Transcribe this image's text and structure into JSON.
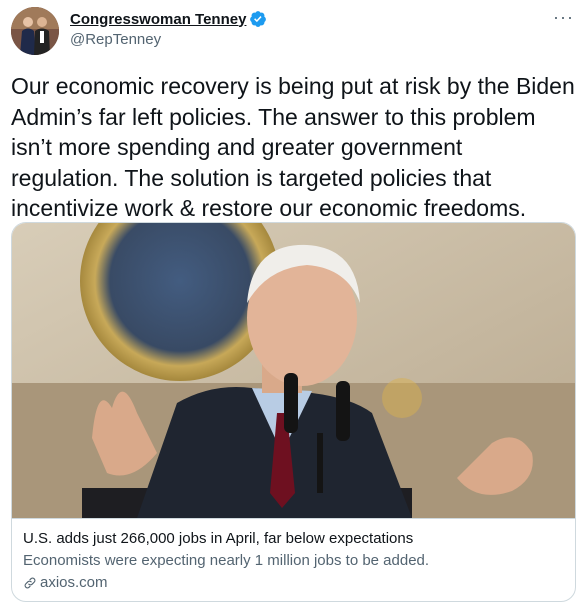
{
  "author": {
    "display_name": "Congresswoman Tenney",
    "handle": "@RepTenney",
    "verified": true,
    "avatar_icon": "profile-photo"
  },
  "menu": {
    "more_label": "···"
  },
  "tweet": {
    "text": "Our economic recovery is being put at risk by the Biden Admin’s far left policies. The answer to this problem isn’t more spending and greater government regulation. The solution is targeted policies that incentivize work & restore our economic freedoms."
  },
  "card": {
    "image_icon": "news-photo",
    "title": "U.S. adds just 266,000 jobs in April, far below expectations",
    "description": "Economists were expecting nearly 1 million jobs to be added.",
    "domain": "axios.com",
    "domain_icon": "link-icon"
  },
  "colors": {
    "text_primary": "#0f1419",
    "text_secondary": "#536471",
    "verified_blue": "#1d9bf0",
    "border": "#cfd9de"
  }
}
